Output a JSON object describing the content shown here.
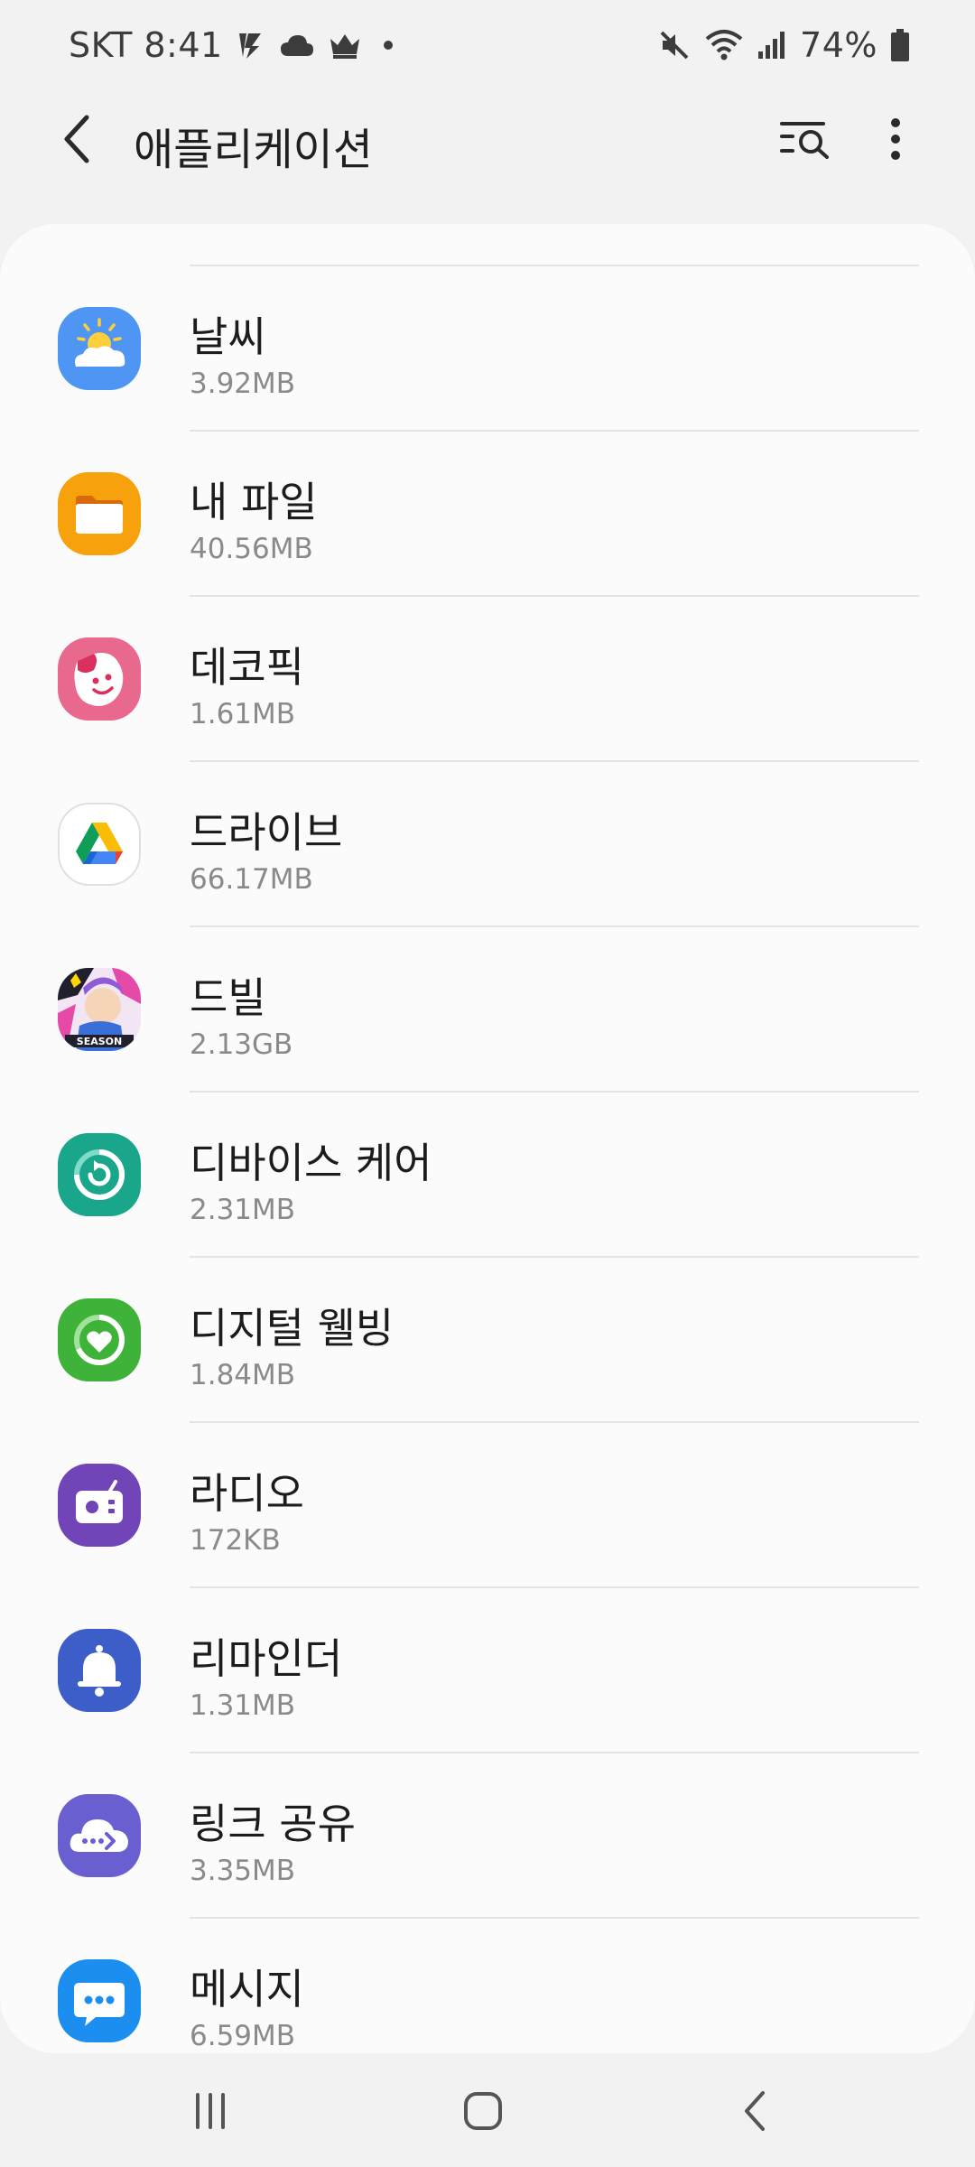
{
  "status_bar": {
    "carrier_time": "SKT 8:41",
    "battery": "74%"
  },
  "header": {
    "title": "애플리케이션"
  },
  "apps": [
    {
      "name": "날씨",
      "size": "3.92MB",
      "icon": "weather-icon"
    },
    {
      "name": "내 파일",
      "size": "40.56MB",
      "icon": "folder-icon"
    },
    {
      "name": "데코픽",
      "size": "1.61MB",
      "icon": "decopic-icon"
    },
    {
      "name": "드라이브",
      "size": "66.17MB",
      "icon": "drive-icon"
    },
    {
      "name": "드빌",
      "size": "2.13GB",
      "icon": "game-icon"
    },
    {
      "name": "디바이스 케어",
      "size": "2.31MB",
      "icon": "device-care-icon"
    },
    {
      "name": "디지털 웰빙",
      "size": "1.84MB",
      "icon": "heart-icon"
    },
    {
      "name": "라디오",
      "size": "172KB",
      "icon": "radio-icon"
    },
    {
      "name": "리마인더",
      "size": "1.31MB",
      "icon": "bell-icon"
    },
    {
      "name": "링크 공유",
      "size": "3.35MB",
      "icon": "cloud-link-icon"
    },
    {
      "name": "메시지",
      "size": "6.59MB",
      "icon": "message-icon"
    }
  ]
}
